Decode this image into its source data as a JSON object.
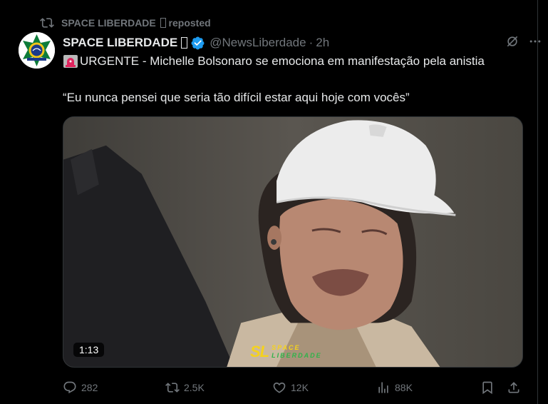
{
  "repost": {
    "user": "SPACE LIBERDADE",
    "suffix": "reposted"
  },
  "author": {
    "name": "SPACE LIBERDADE",
    "handle": "@NewsLiberdade",
    "separator": "·",
    "time": "2h"
  },
  "tweet": {
    "line1": "URGENTE - Michelle Bolsonaro se emociona em manifestação pela anistia",
    "line2": "“Eu nunca pensei que seria tão difícil estar aqui hoje com vocês”"
  },
  "media": {
    "duration": "1:13",
    "watermark_logo": "SL",
    "watermark_line1": "SPACE",
    "watermark_line2": "LIBERDADE"
  },
  "actions": {
    "replies": "282",
    "reposts": "2.5K",
    "likes": "12K",
    "views": "88K"
  },
  "colors": {
    "accent": "#1d9bf0",
    "muted": "#71767b",
    "text": "#e7e9ea",
    "background": "#000000"
  },
  "icons": [
    "repost-icon",
    "verified-icon",
    "grok-icon",
    "more-icon",
    "siren-icon",
    "reply-icon",
    "like-icon",
    "views-icon",
    "bookmark-icon",
    "share-icon"
  ]
}
